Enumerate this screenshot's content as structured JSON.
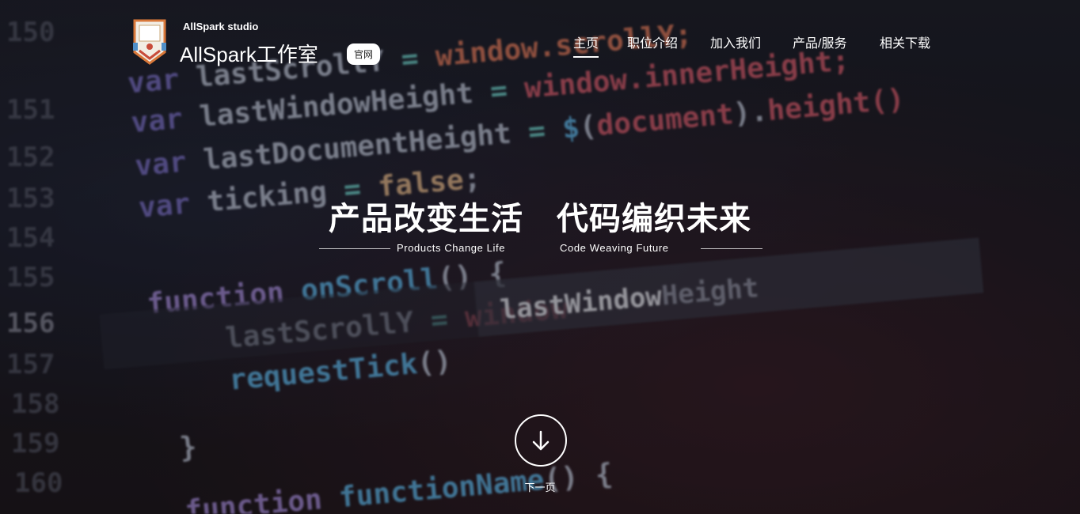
{
  "header": {
    "brand_small": "AllSpark studio",
    "brand_name": "AllSpark工作室",
    "official_tag": "官网"
  },
  "nav": {
    "items": [
      {
        "label": "主页",
        "active": true
      },
      {
        "label": "职位介绍",
        "active": false
      },
      {
        "label": "加入我们",
        "active": false
      },
      {
        "label": "产品/服务",
        "active": false
      },
      {
        "label": "相关下载",
        "active": false
      }
    ]
  },
  "hero": {
    "headline_left": "产品改变生活",
    "headline_right": "代码编织未来",
    "sub_left": "Products Change Life",
    "sub_right": "Code Weaving Future",
    "next_label": "下一页",
    "next_icon": "arrow-down-circle-icon"
  },
  "colors": {
    "text": "#ffffff",
    "background": "#16161e",
    "code_keyword": "#8e7fd6",
    "code_identifier": "#c9cedb",
    "code_string": "#d36a6a",
    "code_value": "#e6b98a"
  }
}
